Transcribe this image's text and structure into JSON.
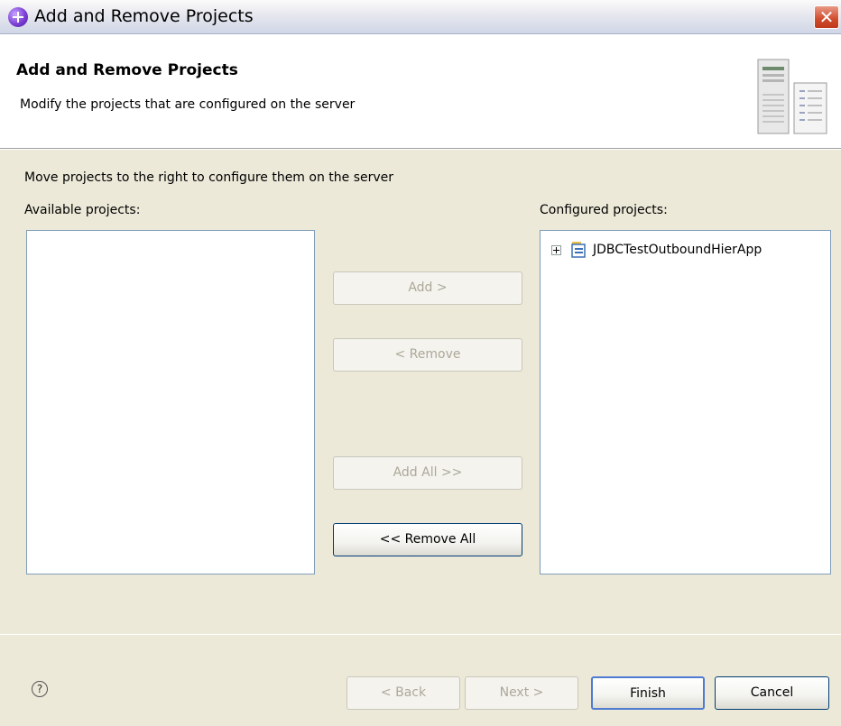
{
  "window": {
    "title": "Add and Remove Projects",
    "close_symbol": "✕"
  },
  "banner": {
    "title": "Add and Remove Projects",
    "description": "Modify the projects that are configured on the server"
  },
  "main": {
    "instruction": "Move projects to the right to configure them on the server",
    "available_label": "Available projects:",
    "configured_label": "Configured projects:",
    "available_projects": [],
    "configured_projects": [
      {
        "label": "JDBCTestOutboundHierApp"
      }
    ]
  },
  "buttons": {
    "add": "Add >",
    "remove": "< Remove",
    "add_all": "Add All >>",
    "remove_all": "<< Remove All"
  },
  "footer": {
    "help_symbol": "?",
    "back": "< Back",
    "next": "Next >",
    "finish": "Finish",
    "cancel": "Cancel"
  },
  "colors": {
    "dialog_bg": "#ece9d8",
    "close_red": "#d04b2c",
    "list_border": "#7f9db9",
    "disabled_text": "#aca899"
  }
}
